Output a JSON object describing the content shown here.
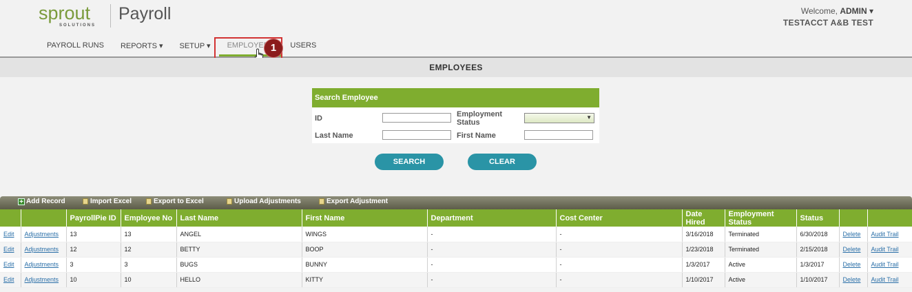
{
  "header": {
    "logo_word": "sprout",
    "logo_sub": "SOLUTIONS",
    "app_name": "Payroll",
    "welcome_prefix": "Welcome,",
    "user": "ADMIN ▾",
    "account": "TESTACCT A&B TEST"
  },
  "nav": {
    "items": [
      "PAYROLL RUNS",
      "REPORTS ▾",
      "SETUP ▾",
      "EMPLOYEES",
      "USERS"
    ],
    "active": "EMPLOYEES"
  },
  "callout": {
    "badge": "1"
  },
  "section_title": "EMPLOYEES",
  "search": {
    "title": "Search Employee",
    "id_label": "ID",
    "id_value": "",
    "status_label": "Employment Status",
    "status_value": "",
    "last_name_label": "Last Name",
    "last_name_value": "",
    "first_name_label": "First Name",
    "first_name_value": "",
    "search_button": "SEARCH",
    "clear_button": "CLEAR"
  },
  "toolbar": {
    "add_record": "Add Record",
    "import_excel": "Import Excel",
    "export_excel": "Export to Excel",
    "upload_adjustments": "Upload Adjustments",
    "export_adjustment": "Export Adjustment"
  },
  "table": {
    "headers": [
      "",
      "",
      "PayrollPie ID",
      "Employee No",
      "Last Name",
      "First Name",
      "Department",
      "Cost Center",
      "Date Hired",
      "Employment Status",
      "Status",
      "",
      ""
    ],
    "rows": [
      {
        "edit": "Edit",
        "adjustments": "Adjustments",
        "pid": "13",
        "empno": "13",
        "last": "ANGEL",
        "first": "WINGS",
        "dept": "-",
        "cost": "-",
        "hired": "3/16/2018",
        "emp_status": "Terminated",
        "status": "6/30/2018",
        "delete": "Delete",
        "audit": "Audit Trail"
      },
      {
        "edit": "Edit",
        "adjustments": "Adjustments",
        "pid": "12",
        "empno": "12",
        "last": "BETTY",
        "first": "BOOP",
        "dept": "-",
        "cost": "-",
        "hired": "1/23/2018",
        "emp_status": "Terminated",
        "status": "2/15/2018",
        "delete": "Delete",
        "audit": "Audit Trail"
      },
      {
        "edit": "Edit",
        "adjustments": "Adjustments",
        "pid": "3",
        "empno": "3",
        "last": "BUGS",
        "first": "BUNNY",
        "dept": "-",
        "cost": "-",
        "hired": "1/3/2017",
        "emp_status": "Active",
        "status": "1/3/2017",
        "delete": "Delete",
        "audit": "Audit Trail"
      },
      {
        "edit": "Edit",
        "adjustments": "Adjustments",
        "pid": "10",
        "empno": "10",
        "last": "HELLO",
        "first": "KITTY",
        "dept": "-",
        "cost": "-",
        "hired": "1/10/2017",
        "emp_status": "Active",
        "status": "1/10/2017",
        "delete": "Delete",
        "audit": "Audit Trail"
      }
    ]
  },
  "colors": {
    "accent_green": "#7fad2f",
    "button_teal": "#2a94a6",
    "callout_red": "#d23232",
    "badge_dark_red": "#8b1c1c"
  }
}
